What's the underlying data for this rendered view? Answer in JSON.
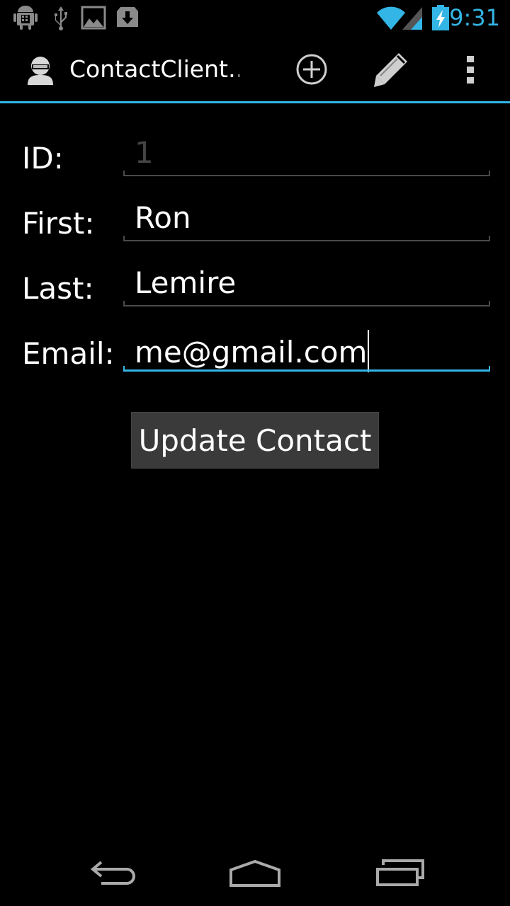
{
  "status_bar": {
    "time": "9:31",
    "icons": [
      "android-debug-icon",
      "usb-icon",
      "image-icon",
      "download-icon",
      "wifi-icon",
      "signal-icon",
      "battery-charging-icon"
    ],
    "accent_color": "#33b5e5"
  },
  "action_bar": {
    "title": "ContactClient…",
    "icons": [
      "contact-avatar-icon",
      "add-circle-icon",
      "edit-pencil-icon",
      "overflow-menu-icon"
    ]
  },
  "form": {
    "id_label": "ID:",
    "id_value": "1",
    "first_label": "First:",
    "first_value": "Ron",
    "last_label": "Last:",
    "last_value": "Lemire",
    "email_label": "Email:",
    "email_value": "me@gmail.com",
    "submit_label": "Update Contact"
  },
  "nav_bar": {
    "icons": [
      "back-icon",
      "home-icon",
      "recent-apps-icon"
    ]
  }
}
